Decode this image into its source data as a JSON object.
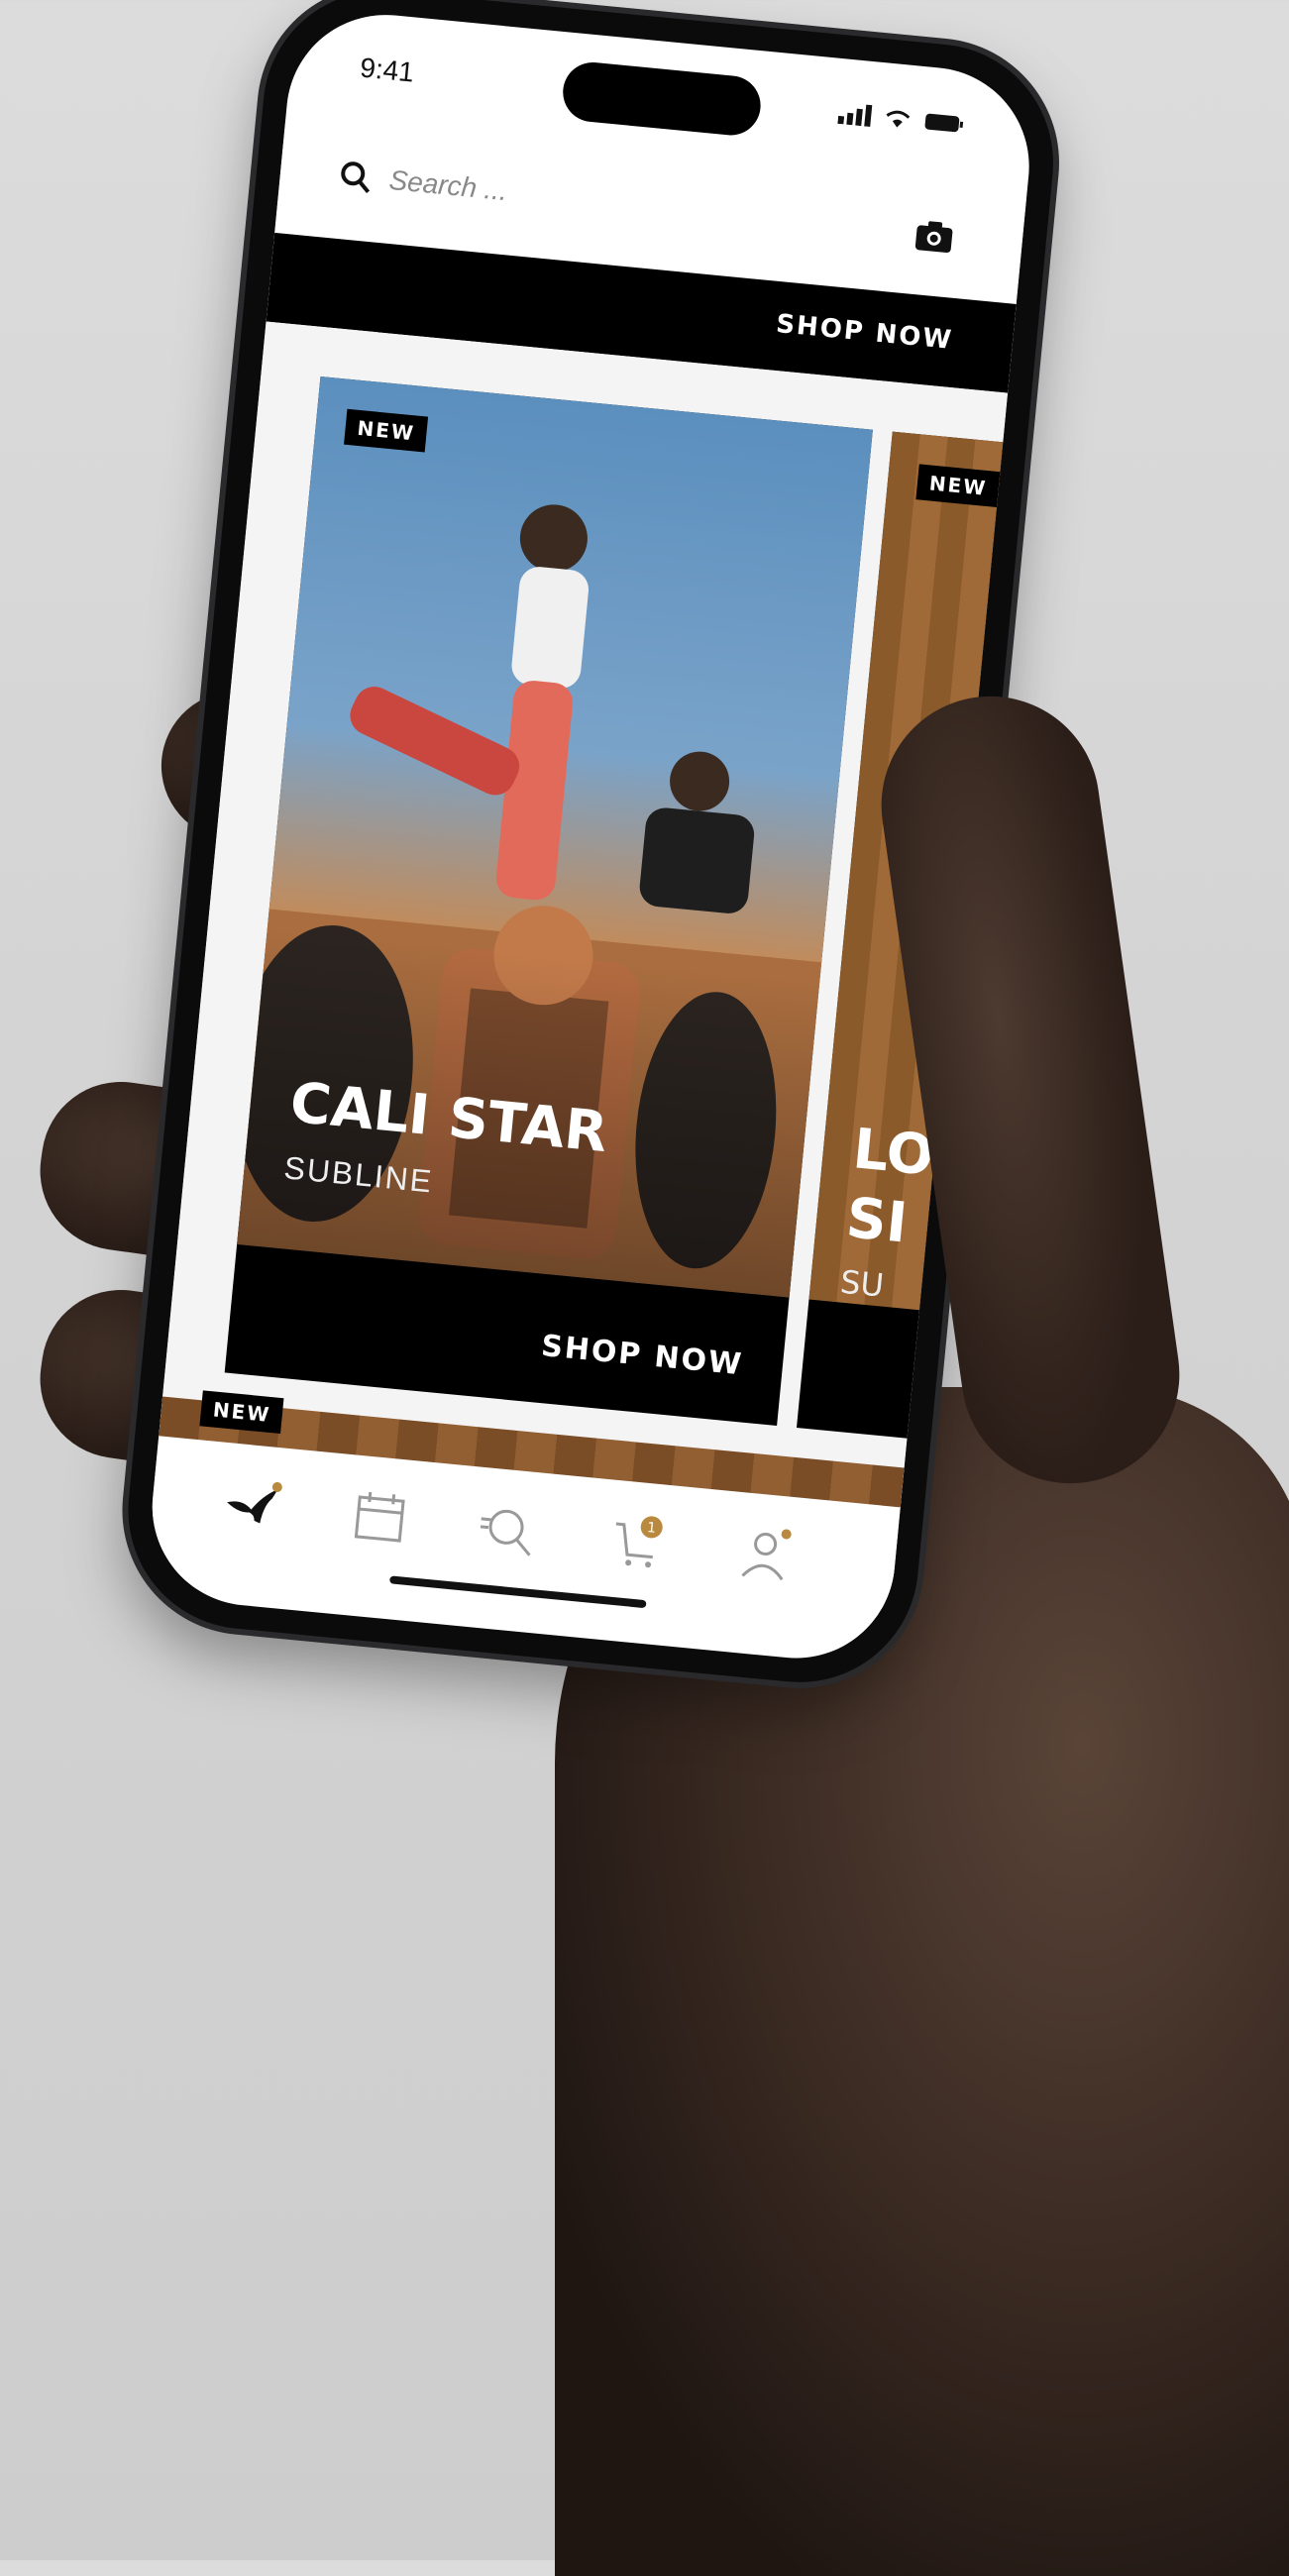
{
  "status_bar": {
    "time": "9:41",
    "icons": "▲ ◆ ▬"
  },
  "search": {
    "placeholder": "Search ..."
  },
  "promo_bar": {
    "cta": "SHOP NOW"
  },
  "cards": [
    {
      "badge": "NEW",
      "title": "CALI STAR",
      "subtitle": "SUBLINE",
      "cta": "SHOP NOW"
    },
    {
      "badge": "NEW",
      "title": "LO\nSI",
      "subtitle": "SU"
    }
  ],
  "strip": {
    "badge": "NEW"
  },
  "tabbar": {
    "items": [
      {
        "icon": "puma-logo-icon"
      },
      {
        "icon": "calendar-icon"
      },
      {
        "icon": "search-icon"
      },
      {
        "icon": "cart-icon",
        "badge": "1"
      },
      {
        "icon": "profile-icon"
      }
    ]
  },
  "colors": {
    "accent_badge": "#b8893e",
    "bar": "#000000",
    "screen_bg": "#ffffff"
  }
}
